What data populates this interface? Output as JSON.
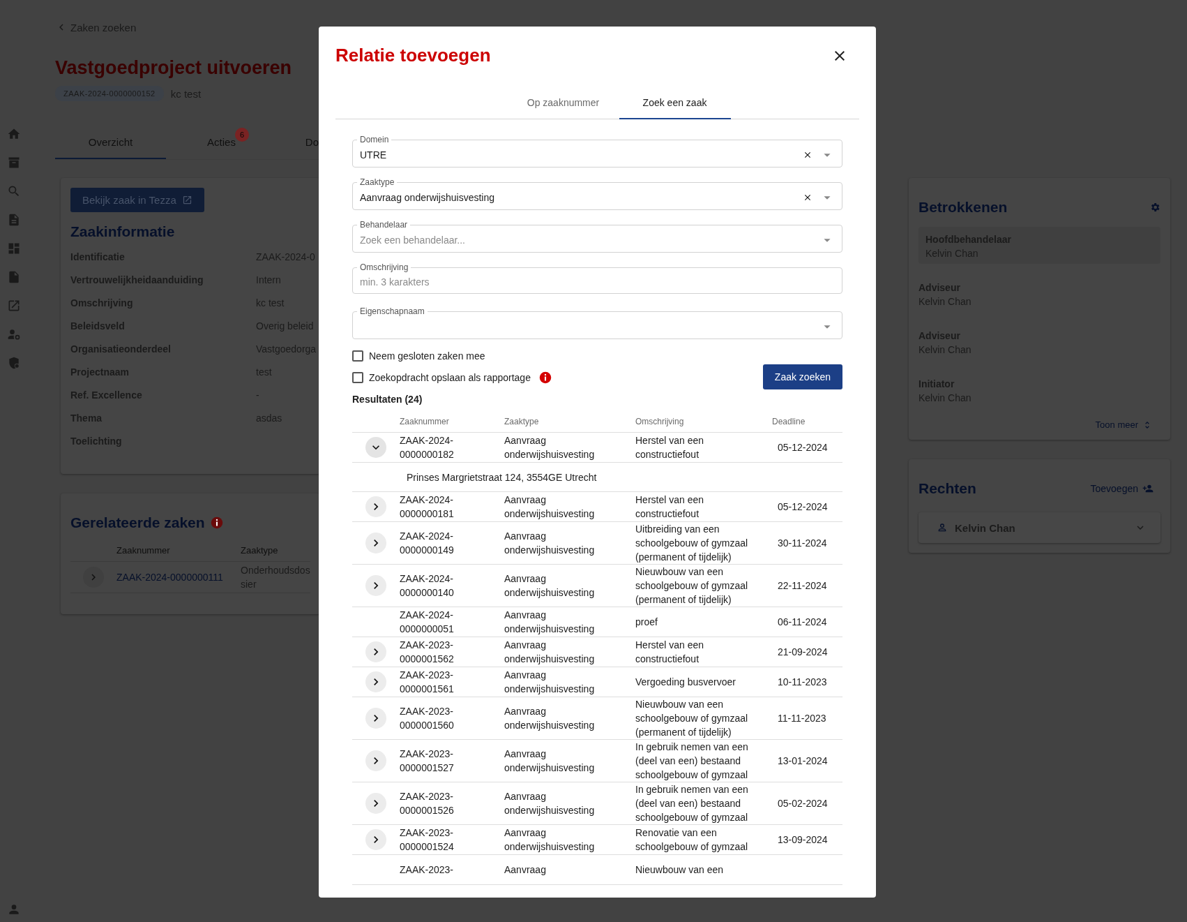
{
  "page": {
    "back_link": "Zaken zoeken",
    "title": "Vastgoedproject uitvoeren",
    "case_id": "ZAAK-2024-0000000152",
    "case_subtitle": "kc test",
    "tabs": [
      {
        "label": "Overzicht",
        "selected": true
      },
      {
        "label": "Acties",
        "selected": false,
        "badge": "6"
      },
      {
        "label": "Do",
        "selected": false
      }
    ],
    "zaakinformatie": {
      "button": "Bekijk zaak in Tezza",
      "title": "Zaakinformatie",
      "fields": [
        {
          "label": "Identificatie",
          "value": "ZAAK-2024-0"
        },
        {
          "label": "Vertrouwelijkheidaanduiding",
          "value": "Intern"
        },
        {
          "label": "Omschrijving",
          "value": "kc test"
        },
        {
          "label": "Beleidsveld",
          "value": "Overig beleid"
        },
        {
          "label": "Organisatieonderdeel",
          "value": "Vastgoedorga"
        },
        {
          "label": "Projectnaam",
          "value": "test"
        },
        {
          "label": "Ref. Excellence",
          "value": "-"
        },
        {
          "label": "Thema",
          "value": "asdas"
        },
        {
          "label": "Toelichting"
        }
      ]
    },
    "gerelateerde_zaken": {
      "title": "Gerelateerde zaken",
      "columns": [
        "Zaaknummer",
        "Zaaktype"
      ],
      "rows": [
        {
          "zaaknummer": "ZAAK-2024-0000000111",
          "zaaktype": "Onderhoudsdossier"
        }
      ]
    },
    "betrokkenen": {
      "title": "Betrokkenen",
      "items": [
        {
          "role": "Hoofdbehandelaar",
          "name": "Kelvin Chan",
          "selected": true
        },
        {
          "role": "Adviseur",
          "name": "Kelvin Chan",
          "selected": false
        },
        {
          "role": "Adviseur",
          "name": "Kelvin Chan",
          "selected": false
        },
        {
          "role": "Initiator",
          "name": "Kelvin Chan",
          "selected": false
        }
      ],
      "toon_meer": "Toon meer"
    },
    "rechten": {
      "title": "Rechten",
      "add": "Toevoegen",
      "items": [
        {
          "name": "Kelvin Chan",
          "expanded": false
        }
      ]
    }
  },
  "dialog": {
    "title": "Relatie toevoegen",
    "tabs": [
      {
        "label": "Op zaaknummer",
        "selected": false
      },
      {
        "label": "Zoek een zaak",
        "selected": true
      }
    ],
    "fields": [
      {
        "kind": "select",
        "label": "Domein",
        "value": "UTRE",
        "clearable": true
      },
      {
        "kind": "select",
        "label": "Zaaktype",
        "value": "Aanvraag onderwijshuisvesting",
        "clearable": true
      },
      {
        "kind": "select",
        "label": "Behandelaar",
        "placeholder": "Zoek een behandelaar...",
        "clearable": false
      },
      {
        "kind": "text",
        "label": "Omschrijving",
        "placeholder": "min. 3 karakters"
      },
      {
        "kind": "select",
        "label": "Eigenschapnaam",
        "clearable": false
      }
    ],
    "checkboxes": [
      {
        "label": "Neem gesloten zaken mee",
        "checked": false,
        "info": false
      },
      {
        "label": "Zoekopdracht opslaan als rapportage",
        "checked": false,
        "info": true
      }
    ],
    "search_button": "Zaak zoeken",
    "results_title": "Resultaten (24)",
    "columns": [
      "Zaaknummer",
      "Zaaktype",
      "Omschrijving",
      "Deadline"
    ],
    "rows": [
      {
        "zaaknummer": "ZAAK-2024-0000000182",
        "zaaktype": "Aanvraag onderwijshuisvesting",
        "omschrijving": "Herstel van een constructiefout",
        "deadline": "05-12-2024",
        "expandable": true,
        "expanded": true,
        "detail": "Prinses Margrietstraat 124, 3554GE Utrecht"
      },
      {
        "zaaknummer": "ZAAK-2024-0000000181",
        "zaaktype": "Aanvraag onderwijshuisvesting",
        "omschrijving": "Herstel van een constructiefout",
        "deadline": "05-12-2024",
        "expandable": true,
        "expanded": false
      },
      {
        "zaaknummer": "ZAAK-2024-0000000149",
        "zaaktype": "Aanvraag onderwijshuisvesting",
        "omschrijving": "Uitbreiding van een schoolgebouw of gymzaal (permanent of tijdelijk)",
        "deadline": "30-11-2024",
        "expandable": true,
        "expanded": false
      },
      {
        "zaaknummer": "ZAAK-2024-0000000140",
        "zaaktype": "Aanvraag onderwijshuisvesting",
        "omschrijving": "Nieuwbouw van een schoolgebouw of gymzaal (permanent of tijdelijk)",
        "deadline": "22-11-2024",
        "expandable": true,
        "expanded": false
      },
      {
        "zaaknummer": "ZAAK-2024-0000000051",
        "zaaktype": "Aanvraag onderwijshuisvesting",
        "omschrijving": "proef",
        "deadline": "06-11-2024",
        "expandable": false,
        "expanded": false
      },
      {
        "zaaknummer": "ZAAK-2023-0000001562",
        "zaaktype": "Aanvraag onderwijshuisvesting",
        "omschrijving": "Herstel van een constructiefout",
        "deadline": "21-09-2024",
        "expandable": true,
        "expanded": false
      },
      {
        "zaaknummer": "ZAAK-2023-0000001561",
        "zaaktype": "Aanvraag onderwijshuisvesting",
        "omschrijving": "Vergoeding busvervoer",
        "deadline": "10-11-2023",
        "expandable": true,
        "expanded": false
      },
      {
        "zaaknummer": "ZAAK-2023-0000001560",
        "zaaktype": "Aanvraag onderwijshuisvesting",
        "omschrijving": "Nieuwbouw van een schoolgebouw of gymzaal (permanent of tijdelijk)",
        "deadline": "11-11-2023",
        "expandable": true,
        "expanded": false
      },
      {
        "zaaknummer": "ZAAK-2023-0000001527",
        "zaaktype": "Aanvraag onderwijshuisvesting",
        "omschrijving": "In gebruik nemen van een (deel van een) bestaand schoolgebouw of gymzaal",
        "deadline": "13-01-2024",
        "expandable": true,
        "expanded": false
      },
      {
        "zaaknummer": "ZAAK-2023-0000001526",
        "zaaktype": "Aanvraag onderwijshuisvesting",
        "omschrijving": "In gebruik nemen van een (deel van een) bestaand schoolgebouw of gymzaal",
        "deadline": "05-02-2024",
        "expandable": true,
        "expanded": false
      },
      {
        "zaaknummer": "ZAAK-2023-0000001524",
        "zaaktype": "Aanvraag onderwijshuisvesting",
        "omschrijving": "Renovatie van een schoolgebouw of gymzaal",
        "deadline": "13-09-2024",
        "expandable": true,
        "expanded": false
      },
      {
        "zaaknummer": "ZAAK-2023-",
        "zaaktype": "Aanvraag",
        "omschrijving": "Nieuwbouw van een",
        "expandable": false,
        "expanded": false
      }
    ]
  }
}
